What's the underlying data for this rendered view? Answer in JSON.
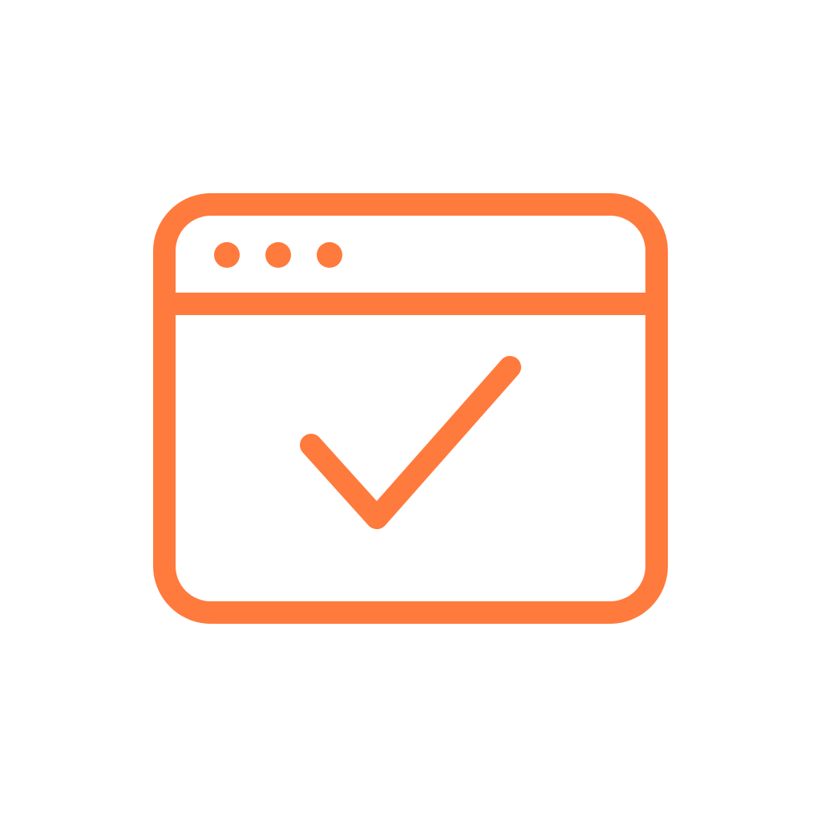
{
  "icon": {
    "name": "browser-window-check-icon",
    "parts": [
      "window-frame",
      "title-bar-divider",
      "window-control-dots",
      "checkmark"
    ],
    "stroke_color": "#FF7A3D",
    "background_color": "#FFFFFF"
  }
}
